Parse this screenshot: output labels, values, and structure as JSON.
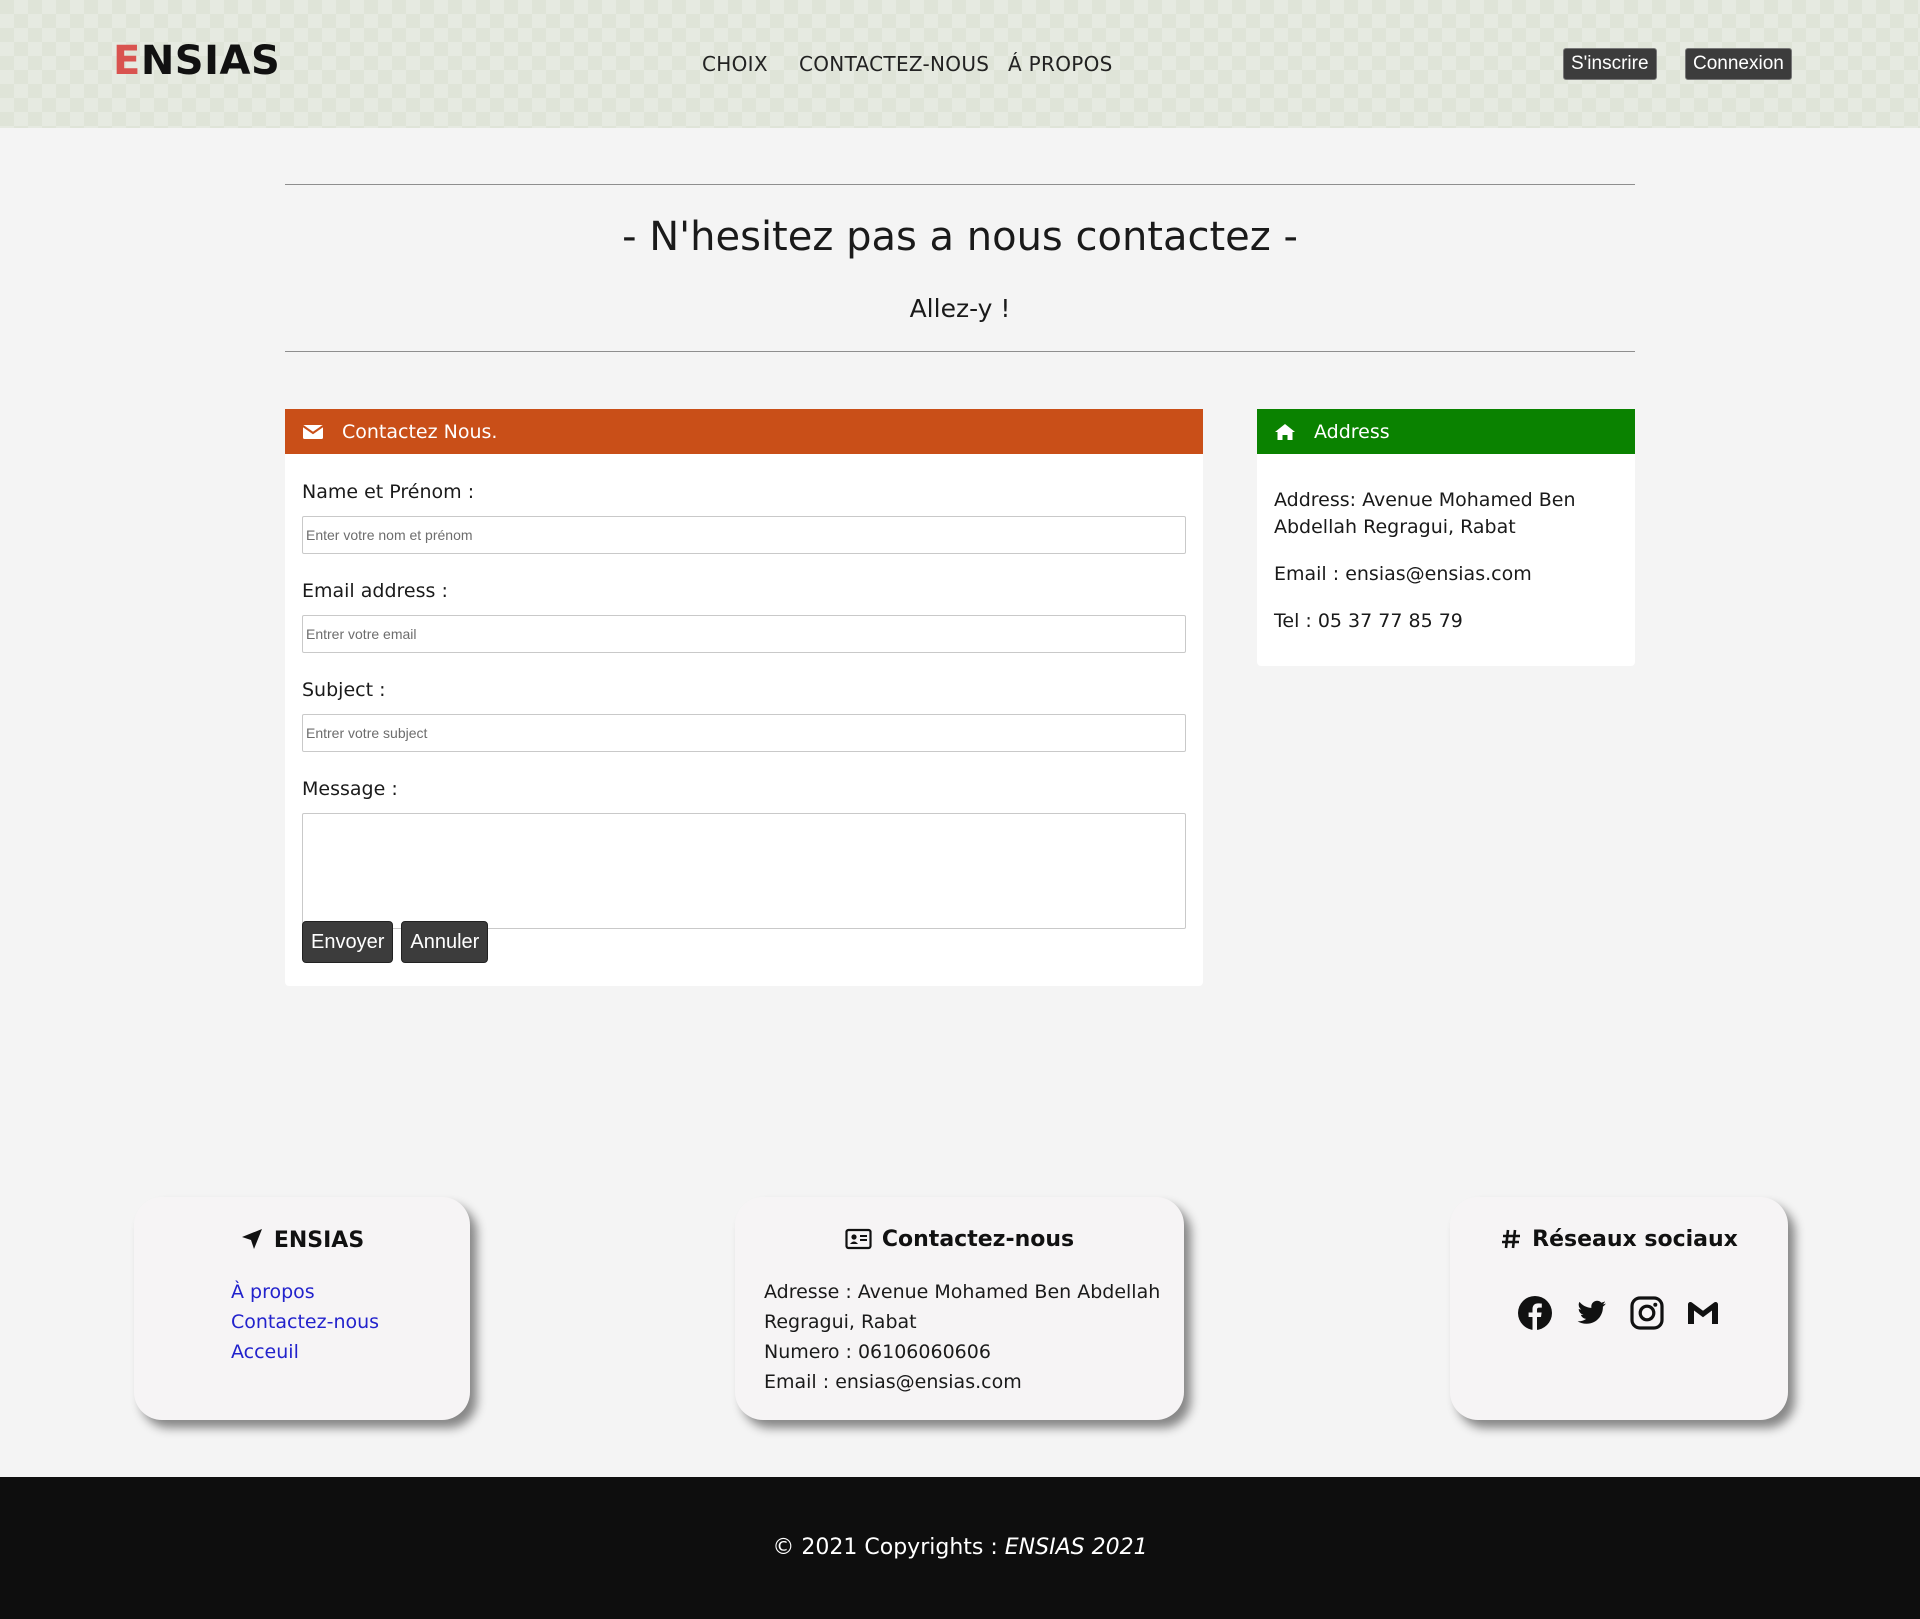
{
  "header": {
    "logo_first": "E",
    "logo_rest": "NSIAS",
    "nav": [
      "CHOIX",
      "CONTACTEZ-NOUS",
      "Á PROPOS"
    ],
    "signup_label": "S'inscrire",
    "login_label": "Connexion"
  },
  "hero": {
    "title": "- N'hesitez pas a nous contactez -",
    "subtitle": "Allez-y !"
  },
  "contact_form": {
    "header": "Contactez Nous.",
    "header_icon": "envelope-icon",
    "name_label": "Name et Prénom :",
    "name_placeholder": "Enter votre nom et prénom",
    "email_label": "Email address :",
    "email_placeholder": "Entrer votre email",
    "subject_label": "Subject :",
    "subject_placeholder": "Entrer votre subject",
    "message_label": "Message :",
    "submit_label": "Envoyer",
    "cancel_label": "Annuler",
    "header_color": "#c94f18"
  },
  "address_card": {
    "header": "Address",
    "header_icon": "home-icon",
    "address": "Address: Avenue Mohamed Ben Abdellah Regragui, Rabat",
    "email": "Email : ensias@ensias.com",
    "tel": "Tel : 05 37 77 85 79",
    "header_color": "#0a8200"
  },
  "footer": {
    "col1": {
      "title": "ENSIAS",
      "icon": "location-arrow-icon",
      "links": [
        "À propos",
        "Contactez-nous",
        "Acceuil"
      ]
    },
    "col2": {
      "title": "Contactez-nous",
      "icon": "address-card-icon",
      "address": "Adresse : Avenue Mohamed Ben Abdellah Regragui, Rabat",
      "numero": "Numero : 06106060606",
      "email": "Email : ensias@ensias.com"
    },
    "col3": {
      "title": "Réseaux sociaux",
      "icon": "hashtag-icon",
      "socials": [
        "facebook-icon",
        "twitter-icon",
        "instagram-icon",
        "gmail-icon"
      ]
    },
    "copyright_prefix": "© 2021 Copyrights : ",
    "copyright_brand": "ENSIAS 2021"
  }
}
